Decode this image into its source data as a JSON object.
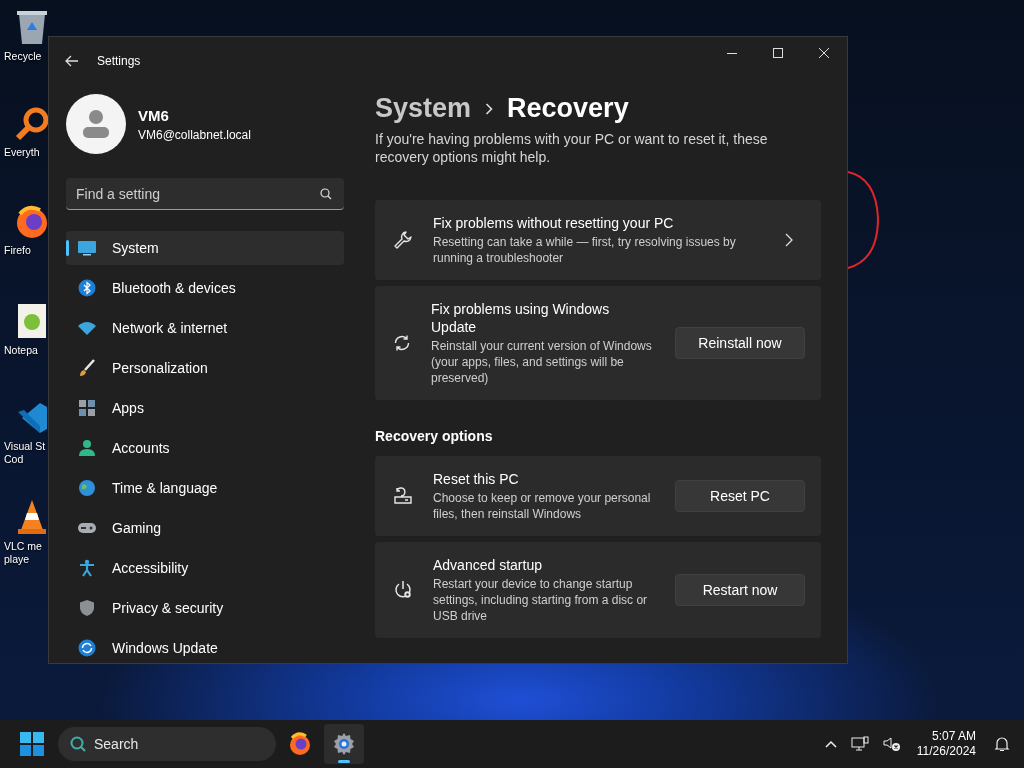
{
  "desktop_icons": [
    {
      "kind": "recycle-bin",
      "lines": [
        "Recycle"
      ]
    },
    {
      "kind": "magnifier",
      "lines": [
        "Everyth"
      ]
    },
    {
      "kind": "browser",
      "lines": [
        "Firefo"
      ]
    },
    {
      "kind": "notepad",
      "lines": [
        "Notepa"
      ]
    },
    {
      "kind": "code-editor",
      "lines": [
        "Visual St",
        "Cod"
      ]
    },
    {
      "kind": "media-player",
      "lines": [
        "VLC me",
        "playe"
      ]
    }
  ],
  "window": {
    "title": "Settings"
  },
  "profile": {
    "name": "VM6",
    "email": "VM6@collabnet.local"
  },
  "search": {
    "placeholder": "Find a setting"
  },
  "nav": [
    {
      "kind": "system",
      "label": "System",
      "selected": true
    },
    {
      "kind": "bluetooth",
      "label": "Bluetooth & devices",
      "selected": false
    },
    {
      "kind": "network",
      "label": "Network & internet",
      "selected": false
    },
    {
      "kind": "personalization",
      "label": "Personalization",
      "selected": false
    },
    {
      "kind": "apps",
      "label": "Apps",
      "selected": false
    },
    {
      "kind": "accounts",
      "label": "Accounts",
      "selected": false
    },
    {
      "kind": "time",
      "label": "Time & language",
      "selected": false
    },
    {
      "kind": "gaming",
      "label": "Gaming",
      "selected": false
    },
    {
      "kind": "accessibility",
      "label": "Accessibility",
      "selected": false
    },
    {
      "kind": "privacy",
      "label": "Privacy & security",
      "selected": false
    },
    {
      "kind": "update",
      "label": "Windows Update",
      "selected": false
    }
  ],
  "breadcrumb": {
    "parent": "System",
    "current": "Recovery"
  },
  "intro": "If you're having problems with your PC or want to reset it, these recovery options might help.",
  "sections": [
    {
      "cards": [
        {
          "kind": "wrench",
          "title": "Fix problems without resetting your PC",
          "description": "Resetting can take a while — first, try resolving issues by running a troubleshooter"
        },
        {
          "kind": "sync",
          "title": "Fix problems using Windows Update",
          "description": "Reinstall your current version of Windows (your apps, files, and settings will be preserved)",
          "button": "Reinstall now"
        }
      ]
    },
    {
      "heading": "Recovery options",
      "cards": [
        {
          "kind": "reset",
          "title": "Reset this PC",
          "description": "Choose to keep or remove your personal files, then reinstall Windows",
          "button": "Reset PC"
        },
        {
          "kind": "power-gear",
          "title": "Advanced startup",
          "description": "Restart your device to change startup settings, including starting from a disc or USB drive",
          "button": "Restart now"
        }
      ]
    }
  ],
  "taskbar": {
    "search": {
      "placeholder": "Search"
    },
    "apps": [
      {
        "kind": "browser",
        "selected": false
      },
      {
        "kind": "settings",
        "selected": true
      }
    ],
    "time": "5:07 AM",
    "date": "11/26/2024"
  }
}
